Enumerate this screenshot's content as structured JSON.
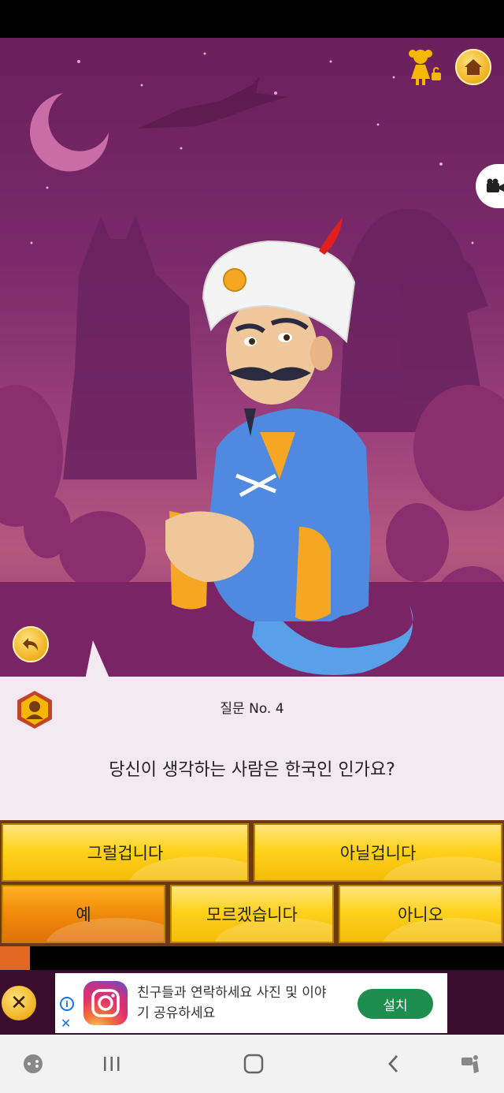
{
  "game": {
    "question_number_label": "질문 No. 4",
    "question_text": "당신이 생각하는 사람은 한국인 인가요?",
    "progress_fraction": 0.06
  },
  "answers": {
    "probably": "그럴겁니다",
    "probably_not": "아닐겁니다",
    "yes": "예",
    "dont_know": "모르겠습니다",
    "no": "아니오",
    "selected": "yes"
  },
  "top_buttons": {
    "profile_icon": "girl-lock-icon",
    "home_icon": "home-icon",
    "video_icon": "video-camera-icon",
    "undo_icon": "undo-icon"
  },
  "ad": {
    "text": "친구들과 연락하세요 사진 및 이야기 공유하세요",
    "install_label": "설치",
    "info_icon": "i",
    "close_icon": "✕"
  },
  "nav_bar": {
    "icons": [
      "game-launcher-icon",
      "recent-apps-icon",
      "home-icon",
      "back-icon",
      "accessibility-icon"
    ]
  },
  "colors": {
    "scene_purple": "#7a2a6a",
    "button_yellow": "#ffd21e",
    "button_selected": "#f08a0a",
    "panel_bg": "#f3e9f1",
    "install_green": "#1e8e4e"
  }
}
